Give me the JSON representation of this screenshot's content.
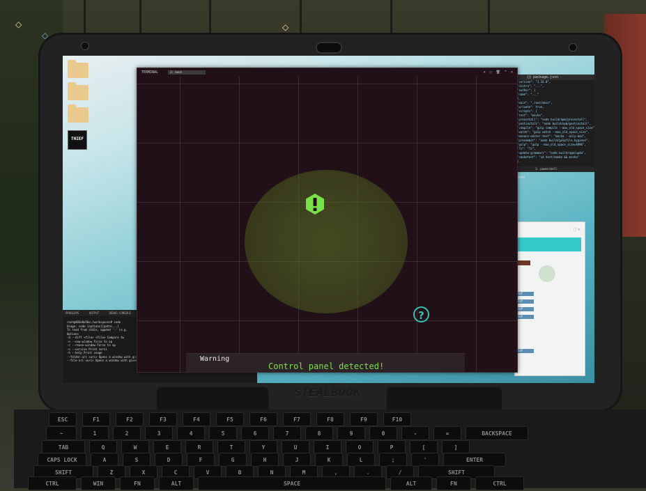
{
  "terminal": {
    "tab_title": "TERMINAL",
    "shell_select": "2: bash",
    "controls": [
      "+",
      "▢",
      "🗑",
      "^",
      "×"
    ]
  },
  "alert": {
    "warning_title": "Warning",
    "message": "Control panel detected!",
    "accent_color": "#7ae04a",
    "help_color": "#33c2b0"
  },
  "help_icon_glyph": "?",
  "desktop_icons": [
    "folder-icon",
    "folder-icon",
    "folder-icon",
    "thief-app-icon"
  ],
  "thief_icon_text": "THIEF",
  "editor": {
    "tabs": "{} package.json",
    "lines": [
      "\"version\": \"1.14.0\",",
      "\"distro\": \"...\",",
      "\"author\": {",
      "\"name\": \"...\"",
      "},",
      "\"main\": \"./out/main\",",
      "\"private\": true,",
      "\"scripts\": {",
      "\"test\": \"mocha\",",
      "\"preinstall\": \"node build/npm/preinstall\",",
      "\"postinstall\": \"node build/npm/postinstall\",",
      "\"compile\": \"gulp compile --max_old_space_size\",",
      "\"watch\": \"gulp watch --max_old_space_size\",",
      "\"monaco-editor-test\": \"mocha --only-mon\",",
      "\"precommit\": \"node build/gulpfile.hygiene\",",
      "\"gulp\": \"gulp --max_old_space_size=4096\",",
      "\"7z\": \"7z\",",
      "\"update-grammars\": \"node build/npm/upda\",",
      "\"smoketest\": \"cd test/smoke && mocha\"",
      "},"
    ],
    "status": "1: powershell"
  },
  "panel_label": "Panel",
  "shop": {
    "tag": "",
    "buy_labels": [
      "BUY",
      "BUY",
      "BUY",
      "BUY",
      "BUY"
    ],
    "caption": ""
  },
  "bg_terminal": {
    "tabs": [
      "PROBLEMS",
      "OUTPUT",
      "DEBUG CONSOLE",
      "TERMINAL"
    ],
    "lines": [
      "root@403e8e56e:/workspaces# code",
      "Usage: code [options][paths...]",
      "",
      "To read from stdin, append '-' (e.g.",
      "",
      "Options",
      "  -d --diff <file> <file> Compare tw",
      "  -n --new-window         Force to op",
      "  -r --reuse-window       Force to op",
      "  -v --version            Print versi",
      "  -h --help               Print usage",
      "  --folder-uri <uri>      Opens a window with given folder uri(s)",
      "  --file-uri <uri>        Opens a window with given file uri(s)"
    ]
  },
  "laptop_brand": "STEALBOOK",
  "keyboard": {
    "fn_row": [
      "ESC",
      "F1",
      "F2",
      "F3",
      "F4",
      "F5",
      "F6",
      "F7",
      "F8",
      "F9",
      "F10"
    ],
    "num_row": [
      "~",
      "1",
      "2",
      "3",
      "4",
      "5",
      "6",
      "7",
      "8",
      "9",
      "0",
      "-",
      "=",
      "BACKSPACE"
    ],
    "q_row": [
      "TAB",
      "Q",
      "W",
      "E",
      "R",
      "T",
      "Y",
      "U",
      "I",
      "O",
      "P",
      "[",
      "]"
    ],
    "a_row": [
      "CAPS LOCK",
      "A",
      "S",
      "D",
      "F",
      "G",
      "H",
      "J",
      "K",
      "L",
      ";",
      "'",
      "ENTER"
    ],
    "z_row": [
      "SHIFT",
      "Z",
      "X",
      "C",
      "V",
      "B",
      "N",
      "M",
      ",",
      ".",
      "/",
      "SHIFT"
    ],
    "bottom_row": [
      "CTRL",
      "WIN",
      "FN",
      "ALT",
      "SPACE",
      "ALT",
      "FN",
      "CTRL"
    ]
  }
}
